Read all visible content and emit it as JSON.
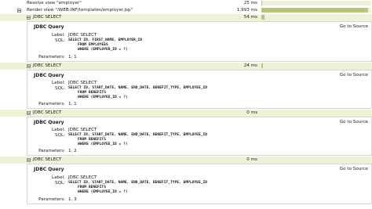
{
  "timeline": {
    "rows": [
      {
        "label": "Resolve view \"employer\"",
        "ms": "25 ms",
        "fraction": 0.01
      },
      {
        "label": "Render view \"/WEB-INF/templates/employer.jsp\"",
        "ms": "1,993 ms",
        "fraction": 0.97
      },
      {
        "label": "JDBC SELECT",
        "ms": "54 ms",
        "fraction": 0.03
      },
      {
        "label": "JDBC SELECT",
        "ms": "24 ms",
        "fraction": 0.012
      },
      {
        "label": "JDBC SELECT",
        "ms": "0 ms",
        "fraction": 0
      },
      {
        "label": "JDBC SELECT",
        "ms": "0 ms",
        "fraction": 0
      }
    ]
  },
  "details": [
    {
      "title": "JDBC Query",
      "goto": "Go to Source",
      "label_key": "Label:",
      "label_val": "JDBC SELECT",
      "sql_key": "SQL:",
      "sql": [
        "SELECT ID, FIRST_NAME, EMPLOYER_ID",
        "FROM EMPLOYEES",
        "WHERE (EMPLOYER_ID = ?)"
      ],
      "params_key": "Parameters:",
      "params": "1, 1"
    },
    {
      "title": "JDBC Query",
      "goto": "Go to Source",
      "label_key": "Label:",
      "label_val": "JDBC SELECT",
      "sql_key": "SQL:",
      "sql": [
        "SELECT ID, START_DATE, NAME, END_DATE, BENEFIT_TYPE, EMPLOYEE_ID",
        "FROM BENEFITS",
        "WHERE (EMPLOYEE_ID = ?)"
      ],
      "params_key": "Parameters:",
      "params": "1, 1"
    },
    {
      "title": "JDBC Query",
      "goto": "Go to Source",
      "label_key": "Label:",
      "label_val": "JDBC SELECT",
      "sql_key": "SQL:",
      "sql": [
        "SELECT ID, START_DATE, NAME, END_DATE, BENEFIT_TYPE, EMPLOYEE_ID",
        "FROM BENEFITS",
        "WHERE (EMPLOYEE_ID = ?)"
      ],
      "params_key": "Parameters:",
      "params": "1, 2"
    },
    {
      "title": "JDBC Query",
      "goto": "Go to Source",
      "label_key": "Label:",
      "label_val": "JDBC SELECT",
      "sql_key": "SQL:",
      "sql": [
        "SELECT ID, START_DATE, NAME, END_DATE, BENEFIT_TYPE, EMPLOYEE_ID",
        "FROM BENEFITS",
        "WHERE (EMPLOYEE_ID = ?)"
      ],
      "params_key": "Parameters:",
      "params": "1, 3"
    }
  ]
}
